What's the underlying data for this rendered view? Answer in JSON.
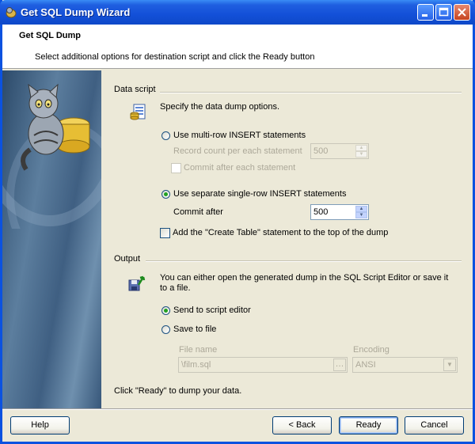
{
  "window": {
    "title": "Get SQL Dump Wizard"
  },
  "header": {
    "title": "Get SQL Dump",
    "description": "Select additional options for destination script and click the Ready button"
  },
  "data_script": {
    "section_title": "Data script",
    "description": "Specify the data dump options.",
    "multi_row_label": "Use multi-row INSERT statements",
    "record_count_label": "Record count per each statement",
    "record_count_value": "500",
    "commit_each_label": "Commit after each statement",
    "single_row_label": "Use separate single-row INSERT statements",
    "commit_after_label": "Commit after",
    "commit_after_value": "500",
    "create_table_label": "Add the \"Create Table\" statement to the top of the dump"
  },
  "output": {
    "section_title": "Output",
    "description_line1": "You can either open the generated dump in the SQL Script Editor or save it",
    "description_line2": "to a file.",
    "send_editor_label": "Send to script editor",
    "save_file_label": "Save to file",
    "file_name_label": "File name",
    "file_name_value": "\\film.sql",
    "encoding_label": "Encoding",
    "encoding_value": "ANSI"
  },
  "footer_hint": "Click \"Ready\" to dump your data.",
  "buttons": {
    "help": "Help",
    "back": "< Back",
    "ready": "Ready",
    "cancel": "Cancel"
  }
}
